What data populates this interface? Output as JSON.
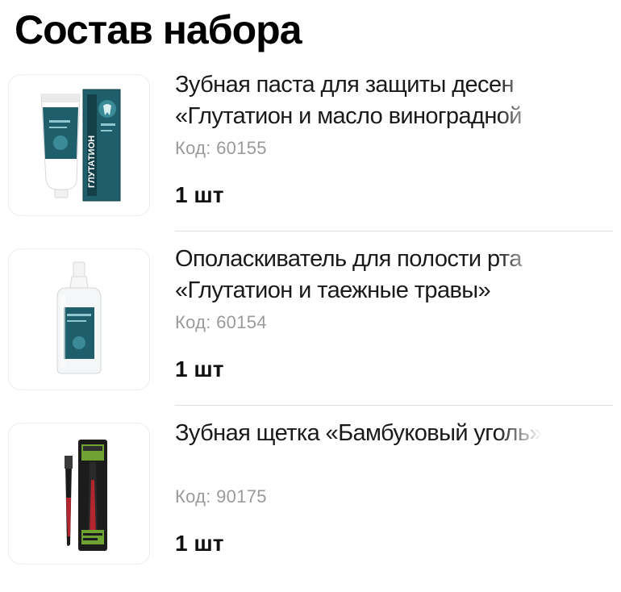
{
  "page": {
    "title": "Состав набора"
  },
  "items": [
    {
      "name": "Зубная паста для защиты десен «Глутатион и масло виноградной косточки»",
      "code": "Код: 60155",
      "qty": "1 шт",
      "image_text": "ГЛУТАТИОН"
    },
    {
      "name": "Ополаскиватель для полости рта «Глутатион и таежные травы»",
      "code": "Код: 60154",
      "qty": "1 шт"
    },
    {
      "name": "Зубная щетка «Бамбуковый уголь»",
      "code": "Код: 90175",
      "qty": "1 шт"
    }
  ],
  "colors": {
    "product_teal": "#1f5f6b",
    "product_teal_dark": "#123f48",
    "brush_red": "#b3252f",
    "brush_green": "#6ea334",
    "divider": "#dddddd",
    "code_gray": "#9a9a9a"
  }
}
